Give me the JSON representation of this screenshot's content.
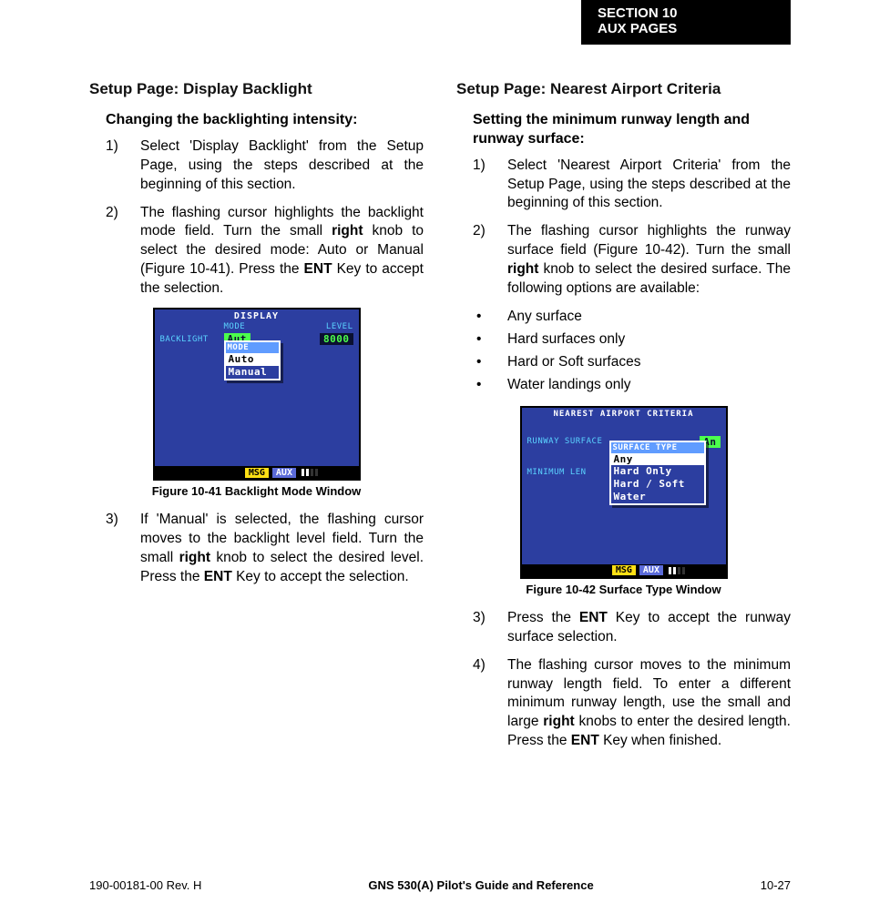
{
  "header": {
    "line1": "SECTION 10",
    "line2": "AUX PAGES"
  },
  "left": {
    "title": "Setup Page: Display Backlight",
    "subtitle": "Changing the backlighting intensity:",
    "steps": {
      "n1": "1)",
      "s1": "Select 'Display Backlight' from the Setup Page, using the steps described at the beginning of this section.",
      "n2": "2)",
      "s2a": "The flashing cursor highlights the backlight mode field.  Turn the small ",
      "s2b": "right",
      "s2c": " knob to select the desired mode: Auto or Manual (Figure 10-41).  Press the ",
      "s2d": "ENT",
      "s2e": " Key to accept the selection.",
      "n3": "3)",
      "s3a": "If 'Manual' is selected, the flashing cursor moves to the backlight level field.  Turn the small ",
      "s3b": "right",
      "s3c": " knob to select the desired level.  Press the ",
      "s3d": "ENT",
      "s3e": " Key to accept the selection."
    },
    "fig": {
      "caption": "Figure 10-41  Backlight Mode Window",
      "title": "DISPLAY",
      "h_mode": "MODE",
      "h_level": "LEVEL",
      "row_label": "BACKLIGHT",
      "mode_val": "Aut",
      "level_val": "8000",
      "popup_hdr": "MODE",
      "opt1": "Auto",
      "opt2": "Manual",
      "msg": "MSG",
      "aux": "AUX"
    }
  },
  "right": {
    "title": "Setup Page: Nearest Airport Criteria",
    "subtitle": "Setting the minimum runway length and runway surface:",
    "steps": {
      "n1": "1)",
      "s1": "Select 'Nearest Airport Criteria' from the Setup Page, using the steps described at the beginning of this section.",
      "n2": "2)",
      "s2a": "The flashing cursor highlights the runway surface field (Figure 10-42).  Turn the small ",
      "s2b": "right",
      "s2c": " knob to select the desired surface.  The following options are available:",
      "b1": "Any surface",
      "b2": "Hard surfaces only",
      "b3": "Hard or Soft surfaces",
      "b4": "Water landings only",
      "n3": "3)",
      "s3a": "Press the ",
      "s3b": "ENT",
      "s3c": " Key to accept the runway surface selection.",
      "n4": "4)",
      "s4a": "The flashing cursor moves to the minimum runway length field.  To enter a different minimum runway length, use the small and large ",
      "s4b": "right",
      "s4c": " knobs to enter the desired length.  Press the ",
      "s4d": "ENT",
      "s4e": " Key when finished."
    },
    "fig": {
      "caption": "Figure 10-42  Surface Type Window",
      "title": "NEAREST AIRPORT CRITERIA",
      "row1_label": "RUNWAY SURFACE",
      "row1_val": "An",
      "row2_label": "MINIMUM LEN",
      "popup_hdr": "SURFACE TYPE",
      "opt1": "Any",
      "opt2": "Hard Only",
      "opt3": "Hard / Soft",
      "opt4": "Water",
      "msg": "MSG",
      "aux": "AUX"
    }
  },
  "footer": {
    "left": "190-00181-00  Rev. H",
    "center": "GNS 530(A) Pilot's Guide and Reference",
    "right": "10-27"
  }
}
